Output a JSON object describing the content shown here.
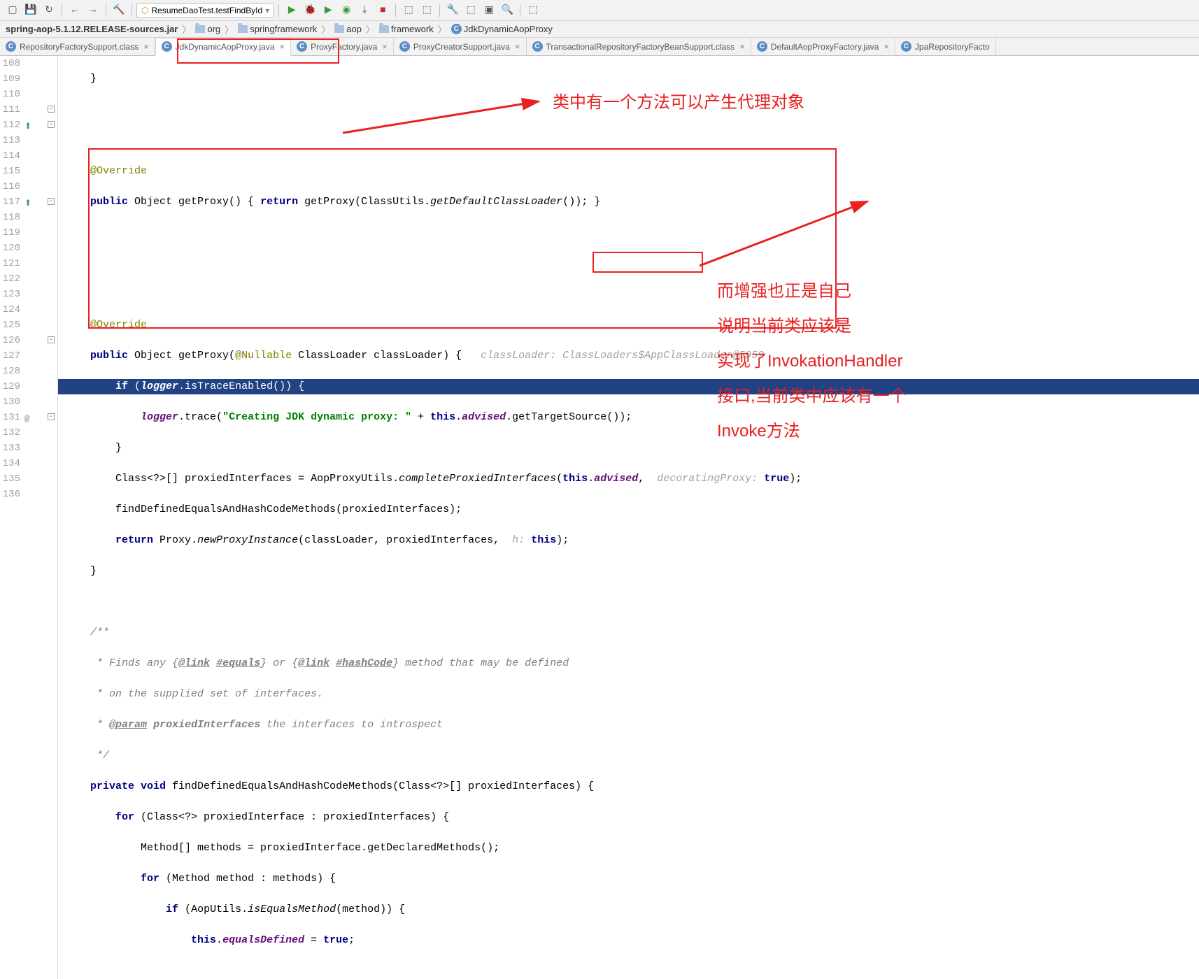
{
  "toolbar": {
    "run_config": "ResumeDaoTest.testFindById"
  },
  "breadcrumb": {
    "jar": "spring-aop-5.1.12.RELEASE-sources.jar",
    "p1": "org",
    "p2": "springframework",
    "p3": "aop",
    "p4": "framework",
    "cls": "JdkDynamicAopProxy"
  },
  "tabs": [
    {
      "label": "RepositoryFactorySupport.class",
      "active": false
    },
    {
      "label": "JdkDynamicAopProxy.java",
      "active": true
    },
    {
      "label": "ProxyFactory.java",
      "active": false
    },
    {
      "label": "ProxyCreatorSupport.java",
      "active": false
    },
    {
      "label": "TransactionalRepositoryFactoryBeanSupport.class",
      "active": false
    },
    {
      "label": "DefaultAopProxyFactory.java",
      "active": false
    },
    {
      "label": "JpaRepositoryFacto",
      "active": false
    }
  ],
  "lines": {
    "start": 108,
    "end": 136,
    "numbers": [
      "108",
      "109",
      "110",
      "111",
      "112",
      "113",
      "114",
      "115",
      "116",
      "117",
      "118",
      "119",
      "120",
      "121",
      "122",
      "123",
      "124",
      "125",
      "126",
      "127",
      "128",
      "129",
      "130",
      "131",
      "132",
      "133",
      "134",
      "135",
      "136"
    ]
  },
  "code": {
    "l112_return": "return",
    "l112_method": "getProxy",
    "l112_util": "ClassUtils",
    "l112_static": "getDefaultClassLoader",
    "l117_hint": "classLoader: ClassLoaders$AppClassLoader@5959",
    "l118_if": "if",
    "l118_logger": "logger",
    "l119_logger": "logger",
    "l119_str": "\"Creating JDK dynamic proxy: \"",
    "l119_this": "this",
    "l119_advised": "advised",
    "l121_util": "AopProxyUtils",
    "l121_static": "completeProxiedInterfaces",
    "l121_this": "this",
    "l121_advised": "advised",
    "l121_hint": "decoratingProxy:",
    "l121_true": "true",
    "l123_return": "return",
    "l123_proxy": "Proxy",
    "l123_static": "newProxyInstance",
    "l123_hint": "h:",
    "l123_this": "this",
    "l127_link1": "@link",
    "l127_eq": "#equals",
    "l127_link2": "@link",
    "l127_hc": "#hashCode",
    "l129_param": "@param",
    "l129_name": "proxiedInterfaces",
    "l131_kw": "private void",
    "l132_for": "for",
    "l134_for": "for",
    "l135_if": "if",
    "l135_util": "AopUtils",
    "l135_static": "isEqualsMethod",
    "l136_this": "this",
    "l136_fld": "equalsDefined",
    "l136_true": "true"
  },
  "annotations": {
    "top": "类中有一个方法可以产生代理对象",
    "right1": "而增强也正是自己",
    "right2": "说明当前类应该是",
    "right3": "实现了InvokationHandler",
    "right4": "接口,当前类中应该有一个",
    "right5": "Invoke方法"
  }
}
